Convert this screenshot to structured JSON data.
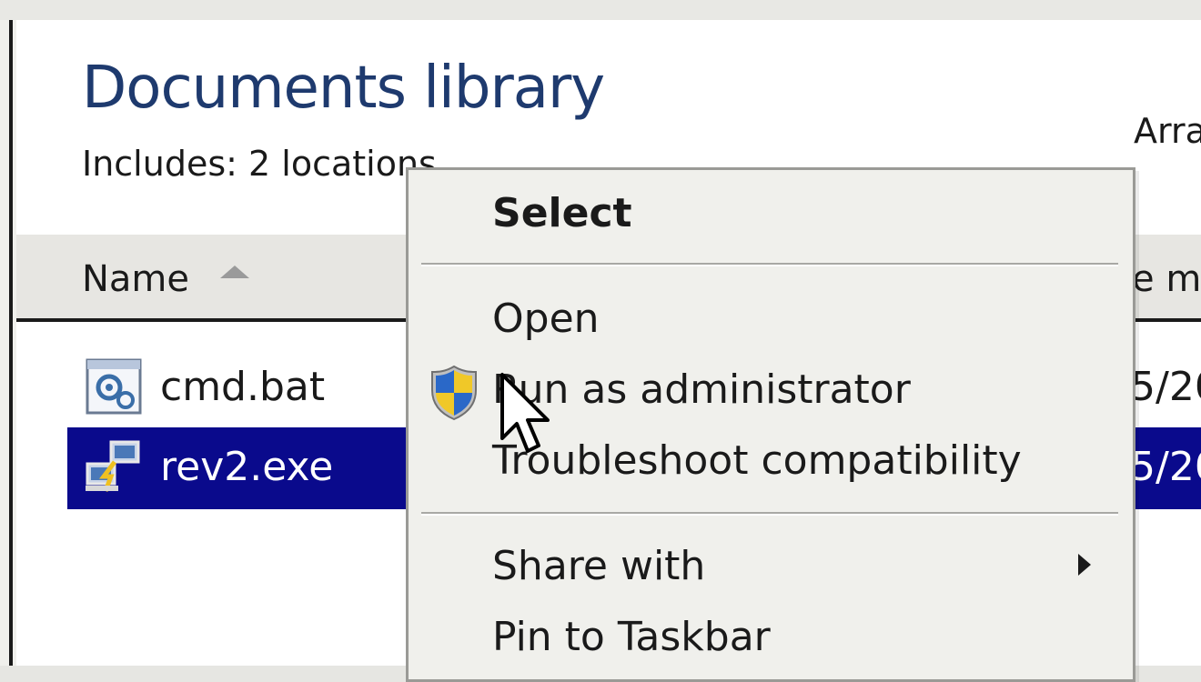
{
  "library": {
    "title": "Documents library",
    "includes": "Includes:  2 locations",
    "arrange_label": "Arra"
  },
  "columns": {
    "name": "Name",
    "date_partial": "e m"
  },
  "files": [
    {
      "name": "cmd.bat",
      "date_partial": "5/20",
      "icon": "batch-file-icon",
      "selected": false
    },
    {
      "name": "rev2.exe",
      "date_partial": "5/20",
      "icon": "executable-icon",
      "selected": true
    }
  ],
  "context_menu": {
    "select": "Select",
    "open": "Open",
    "run_as_admin": "Run as administrator",
    "troubleshoot": "Troubleshoot compatibility",
    "share_with": "Share with",
    "pin_taskbar": "Pin to Taskbar"
  },
  "colors": {
    "title": "#1e3a6e",
    "selection": "#0a0a8c",
    "menu_bg": "#f0f0ec"
  }
}
